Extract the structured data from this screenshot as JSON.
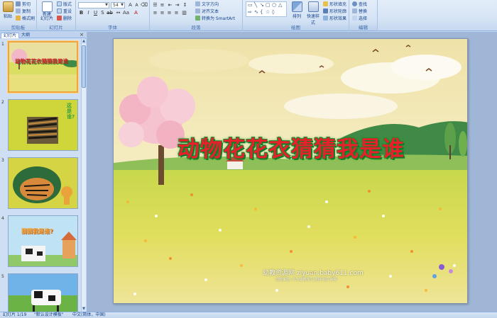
{
  "ribbon": {
    "clipboard": {
      "paste": "粘贴",
      "cut": "剪切",
      "copy": "复制",
      "format_painter": "格式刷",
      "label": "剪贴板"
    },
    "slides": {
      "new_slide": "新建\n幻灯片",
      "layout": "版式",
      "reset": "重设",
      "delete": "删除",
      "label": "幻灯片"
    },
    "font": {
      "size": "54",
      "label": "字体"
    },
    "paragraph": {
      "text_direction": "文字方向",
      "align_text": "对齐文本",
      "convert_smartart": "转换为 SmartArt",
      "label": "段落"
    },
    "drawing": {
      "arrange": "排列",
      "quick_styles": "快速样式",
      "shape_fill": "形状填充",
      "shape_outline": "形状轮廓",
      "shape_effects": "形状效果",
      "label": "绘图"
    },
    "editing": {
      "find": "查找",
      "replace": "替换",
      "select": "选择",
      "label": "编辑"
    }
  },
  "left_pane": {
    "tabs": [
      "幻灯片",
      "大纲"
    ],
    "active_tab": "幻灯片",
    "close": "×",
    "thumbnails": [
      {
        "num": "1",
        "title": "动物花花衣猜猜我是谁"
      },
      {
        "num": "2",
        "title": "这是谁?"
      },
      {
        "num": "3",
        "title": ""
      },
      {
        "num": "4",
        "title": "猜猜我是谁?"
      },
      {
        "num": "5",
        "title": ""
      }
    ]
  },
  "slide": {
    "title": "动物花花衣猜猜我是谁",
    "watermark": "幼教资源网 ziyuan.baby611.com",
    "watermark_sub": "内容来自: 只为幼教而生 更好资源 来网"
  },
  "status_bar": {
    "slide_count": "幻灯片 1/19",
    "theme": "\"默认设计模板\"",
    "language": "中文(简体，中国)"
  },
  "colors": {
    "accent": "#15428b",
    "title_red": "#e8202a",
    "title_green": "#0f7d2a",
    "selection": "#f0a540"
  }
}
